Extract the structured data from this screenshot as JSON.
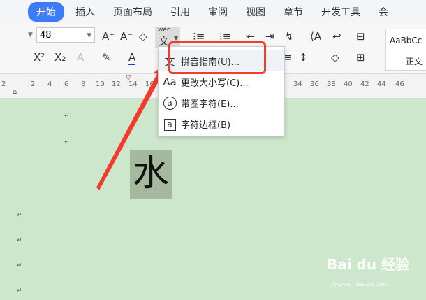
{
  "tabs": [
    "开始",
    "插入",
    "页面布局",
    "引用",
    "审阅",
    "视图",
    "章节",
    "开发工具",
    "会"
  ],
  "toolbar": {
    "font_size": "48",
    "row1_icons": [
      "A⁺",
      "A⁻",
      "◇",
      "⁝≡",
      "⁝≡",
      "⇤",
      "⇥",
      "↯",
      "⟨A",
      "↩",
      "⊟"
    ],
    "row2_icons": [
      "X²",
      "X₂",
      "A",
      "✎",
      "A",
      "≡",
      "↕",
      "◇",
      "⊞"
    ],
    "pinyin_top": "wén",
    "pinyin_char": "文",
    "style_sample": "AaBbCc",
    "style_name": "正文"
  },
  "ruler": {
    "ticks": [
      "2",
      "2",
      "4",
      "6",
      "8",
      "10",
      "12",
      "14",
      "16",
      "34",
      "36",
      "38",
      "40",
      "42",
      "44",
      "46"
    ]
  },
  "document": {
    "character": "水"
  },
  "menu": {
    "items": [
      {
        "icon": "文",
        "label": "拼音指南(U)..."
      },
      {
        "icon": "Aa",
        "label": "更改大小写(C)..."
      },
      {
        "icon": "a",
        "label": "带圈字符(E)..."
      },
      {
        "icon": "a",
        "label": "字符边框(B)"
      }
    ]
  },
  "watermark": {
    "brand": "Bai du 经验",
    "url": "jingyan.baidu.com"
  },
  "colors": {
    "accent": "#3d7cf6",
    "page_background": "#cde7cc",
    "annotation_red": "#f23b2d"
  }
}
